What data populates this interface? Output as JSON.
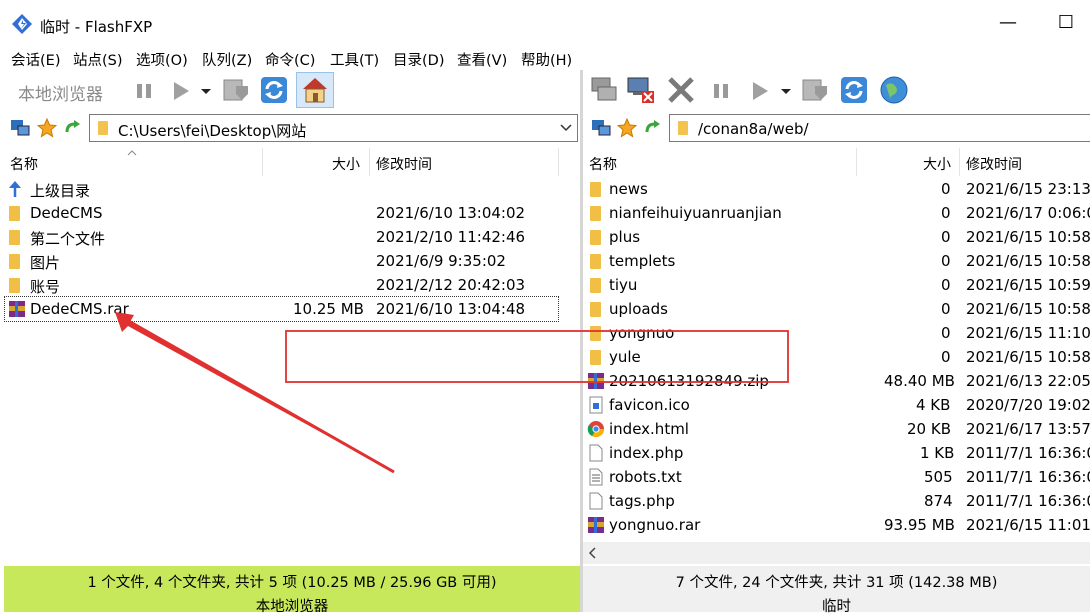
{
  "window": {
    "title": "临时 - FlashFXP",
    "minimize": "—",
    "maximize": "☐"
  },
  "menu": [
    "会话(E)",
    "站点(S)",
    "选项(O)",
    "队列(Z)",
    "命令(C)",
    "工具(T)",
    "目录(D)",
    "查看(V)",
    "帮助(H)"
  ],
  "local": {
    "toolbar_label": "本地浏览器",
    "path": "C:\\Users\\fei\\Desktop\\网站",
    "columns": {
      "name": "名称",
      "size": "大小",
      "modified": "修改时间"
    },
    "rows": [
      {
        "name": "上级目录",
        "size": "",
        "modified": "",
        "icon": "up-dir-icon"
      },
      {
        "name": "DedeCMS",
        "size": "",
        "modified": "2021/6/10 13:04:02",
        "icon": "folder-icon"
      },
      {
        "name": "第二个文件",
        "size": "",
        "modified": "2021/2/10 11:42:46",
        "icon": "folder-icon"
      },
      {
        "name": "图片",
        "size": "",
        "modified": "2021/6/9 9:35:02",
        "icon": "folder-icon"
      },
      {
        "name": "账号",
        "size": "",
        "modified": "2021/2/12 20:42:03",
        "icon": "folder-icon"
      },
      {
        "name": "DedeCMS.rar",
        "size": "10.25 MB",
        "modified": "2021/6/10 13:04:48",
        "icon": "rar-icon"
      }
    ],
    "status": "1 个文件, 4 个文件夹, 共计 5 项 (10.25 MB / 25.96 GB 可用)",
    "status_label": "本地浏览器",
    "status_color": "#c7e85b"
  },
  "remote": {
    "path": "/conan8a/web/",
    "columns": {
      "name": "名称",
      "size": "大小",
      "modified": "修改时间"
    },
    "rows": [
      {
        "name": "news",
        "size": "0",
        "modified": "2021/6/15 23:13:",
        "icon": "folder-icon"
      },
      {
        "name": "nianfeihuiyuanruanjian",
        "size": "0",
        "modified": "2021/6/17 0:06:0",
        "icon": "folder-icon"
      },
      {
        "name": "plus",
        "size": "0",
        "modified": "2021/6/15 10:58:",
        "icon": "folder-icon"
      },
      {
        "name": "templets",
        "size": "0",
        "modified": "2021/6/15 10:58:",
        "icon": "folder-icon"
      },
      {
        "name": "tiyu",
        "size": "0",
        "modified": "2021/6/15 10:59:",
        "icon": "folder-icon"
      },
      {
        "name": "uploads",
        "size": "0",
        "modified": "2021/6/15 10:58:",
        "icon": "folder-icon"
      },
      {
        "name": "yongnuo",
        "size": "0",
        "modified": "2021/6/15 11:10:",
        "icon": "folder-icon"
      },
      {
        "name": "yule",
        "size": "0",
        "modified": "2021/6/15 10:58:",
        "icon": "folder-icon"
      },
      {
        "name": "20210613192849.zip",
        "size": "48.40 MB",
        "modified": "2021/6/13 22:05:",
        "icon": "zip-icon"
      },
      {
        "name": "favicon.ico",
        "size": "4 KB",
        "modified": "2020/7/20 19:02:",
        "icon": "ico-icon"
      },
      {
        "name": "index.html",
        "size": "20 KB",
        "modified": "2021/6/17 13:57:",
        "icon": "chrome-icon"
      },
      {
        "name": "index.php",
        "size": "1 KB",
        "modified": "2011/7/1 16:36:0",
        "icon": "document-icon"
      },
      {
        "name": "robots.txt",
        "size": "505",
        "modified": "2011/7/1 16:36:0",
        "icon": "text-file-icon"
      },
      {
        "name": "tags.php",
        "size": "874",
        "modified": "2011/7/1 16:36:0",
        "icon": "document-icon"
      },
      {
        "name": "yongnuo.rar",
        "size": "93.95 MB",
        "modified": "2021/6/15 11:01:",
        "icon": "rar-icon"
      }
    ],
    "status": "7 个文件, 24 个文件夹, 共计 31 项 (142.38 MB)",
    "status_label": "临时",
    "status_color": "#f0f0f0"
  },
  "annotation_color": "#e03030"
}
